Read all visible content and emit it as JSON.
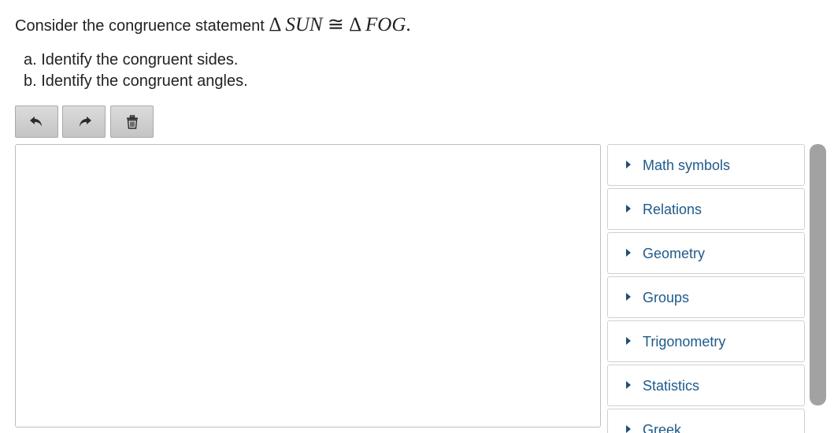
{
  "question": {
    "intro": "Consider the congruence statement",
    "triangle_symbol": "Δ",
    "triangle1": "SUN",
    "congruent_symbol": "≅",
    "triangle2": "FOG",
    "period": ".",
    "part_a": "a. Identify the congruent sides.",
    "part_b": "b. Identify the congruent angles."
  },
  "toolbar": {
    "undo_icon": "undo-icon",
    "redo_icon": "redo-icon",
    "delete_icon": "trash-icon"
  },
  "editor": {
    "value": ""
  },
  "palette": {
    "items": [
      {
        "label": "Math symbols"
      },
      {
        "label": "Relations"
      },
      {
        "label": "Geometry"
      },
      {
        "label": "Groups"
      },
      {
        "label": "Trigonometry"
      },
      {
        "label": "Statistics"
      },
      {
        "label": "Greek"
      }
    ]
  },
  "colors": {
    "link_blue": "#1f5a8a",
    "button_gray": "#c4c4c4",
    "scroll_thumb": "#a2a2a2"
  }
}
